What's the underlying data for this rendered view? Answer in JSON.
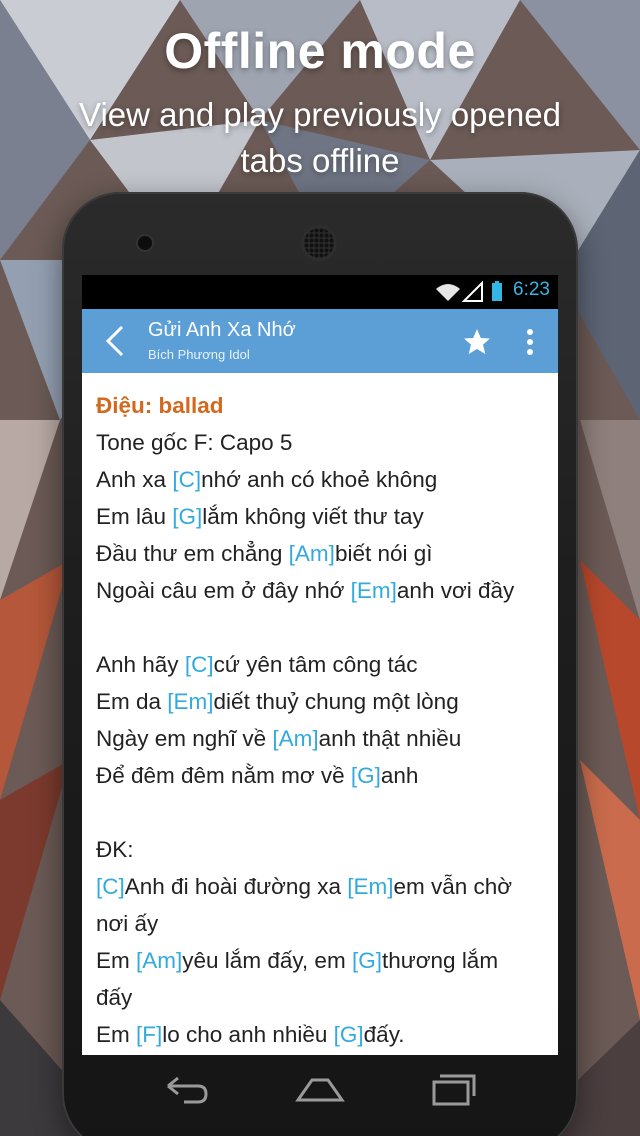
{
  "promo": {
    "headline": "Offline mode",
    "subheadline_line1": "View and play previously opened",
    "subheadline_line2": "tabs offline"
  },
  "status_bar": {
    "time": "6:23",
    "icons": [
      "wifi-icon",
      "signal-icon",
      "battery-icon"
    ],
    "accent_color": "#33b5e5"
  },
  "app_bar": {
    "title": "Gửi Anh Xa Nhớ",
    "subtitle": "Bích Phương Idol",
    "color": "#5b9fd6",
    "actions": [
      "back-icon",
      "star-icon",
      "more-vert-icon"
    ]
  },
  "song": {
    "lines": [
      {
        "type": "title",
        "parts": [
          {
            "t": "Điệu: ballad"
          }
        ]
      },
      {
        "type": "text",
        "parts": [
          {
            "t": "Tone gốc F: Capo 5"
          }
        ]
      },
      {
        "type": "text",
        "parts": [
          {
            "t": "Anh xa "
          },
          {
            "c": "[C]"
          },
          {
            "t": "nhớ anh có khoẻ không"
          }
        ]
      },
      {
        "type": "text",
        "parts": [
          {
            "t": "Em lâu "
          },
          {
            "c": "[G]"
          },
          {
            "t": "lắm không viết thư tay"
          }
        ]
      },
      {
        "type": "text",
        "parts": [
          {
            "t": "Đầu thư em chẳng "
          },
          {
            "c": "[Am]"
          },
          {
            "t": "biết nói gì"
          }
        ]
      },
      {
        "type": "text",
        "parts": [
          {
            "t": "Ngoài câu em ở đây nhớ "
          },
          {
            "c": "[Em]"
          },
          {
            "t": "anh vơi đầy"
          }
        ]
      },
      {
        "type": "blank",
        "parts": []
      },
      {
        "type": "text",
        "parts": [
          {
            "t": "Anh hãy "
          },
          {
            "c": "[C]"
          },
          {
            "t": "cứ yên tâm công tác"
          }
        ]
      },
      {
        "type": "text",
        "parts": [
          {
            "t": "Em da "
          },
          {
            "c": "[Em]"
          },
          {
            "t": "diết thuỷ chung một lòng"
          }
        ]
      },
      {
        "type": "text",
        "parts": [
          {
            "t": "Ngày em nghĩ về "
          },
          {
            "c": "[Am]"
          },
          {
            "t": "anh thật nhiều"
          }
        ]
      },
      {
        "type": "text",
        "parts": [
          {
            "t": "Để đêm đêm nằm mơ về "
          },
          {
            "c": "[G]"
          },
          {
            "t": "anh"
          }
        ]
      },
      {
        "type": "blank",
        "parts": []
      },
      {
        "type": "text",
        "parts": [
          {
            "t": "ĐK:"
          }
        ]
      },
      {
        "type": "text",
        "parts": [
          {
            "c": "[C]"
          },
          {
            "t": "Anh đi hoài đường xa "
          },
          {
            "c": "[Em]"
          },
          {
            "t": "em vẫn chờ"
          }
        ]
      },
      {
        "type": "text",
        "parts": [
          {
            "t": "nơi ấy"
          }
        ]
      },
      {
        "type": "text",
        "parts": [
          {
            "t": "Em "
          },
          {
            "c": "[Am]"
          },
          {
            "t": "yêu lắm đấy, em "
          },
          {
            "c": "[G]"
          },
          {
            "t": "thương lắm"
          }
        ]
      },
      {
        "type": "text",
        "parts": [
          {
            "t": "đấy"
          }
        ]
      },
      {
        "type": "text",
        "parts": [
          {
            "t": "Em "
          },
          {
            "c": "[F]"
          },
          {
            "t": "lo cho anh nhiều "
          },
          {
            "c": "[G]"
          },
          {
            "t": "đấy."
          }
        ]
      }
    ],
    "title_color": "#d2691e",
    "chord_color": "#33aadd"
  },
  "nav_bar": {
    "buttons": [
      "back-nav-icon",
      "home-icon",
      "recents-icon"
    ]
  }
}
